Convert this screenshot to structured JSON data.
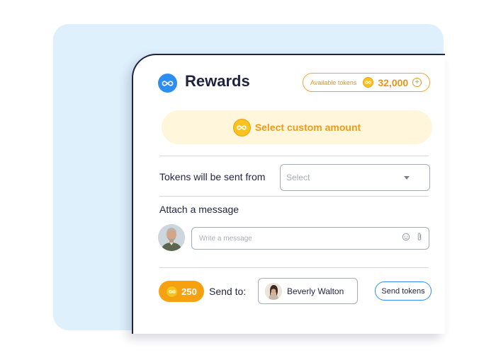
{
  "header": {
    "title": "Rewards",
    "available_label": "Available tokens",
    "available_amount": "32,000"
  },
  "custom_amount": {
    "label": "Select custom amount"
  },
  "sent_from": {
    "label": "Tokens will be sent from",
    "placeholder": "Select"
  },
  "attach": {
    "label": "Attach a message",
    "placeholder": "Write a message"
  },
  "footer": {
    "token_amount": "250",
    "send_to_label": "Send to:",
    "recipient_name": "Beverly Walton",
    "send_button": "Send tokens"
  },
  "icons": {
    "logo": "infinity-icon",
    "coin": "coin-icon",
    "add": "plus-circle-icon",
    "caret": "chevron-down-icon",
    "emoji": "smile-icon",
    "attach": "paperclip-icon"
  },
  "colors": {
    "brand_blue": "#2d8ef2",
    "token_orange": "#f09a16",
    "coin_yellow": "#f8c21f",
    "navy": "#1f2340",
    "highlight_bg": "#fff6dc",
    "backdrop": "#dff0fd"
  }
}
